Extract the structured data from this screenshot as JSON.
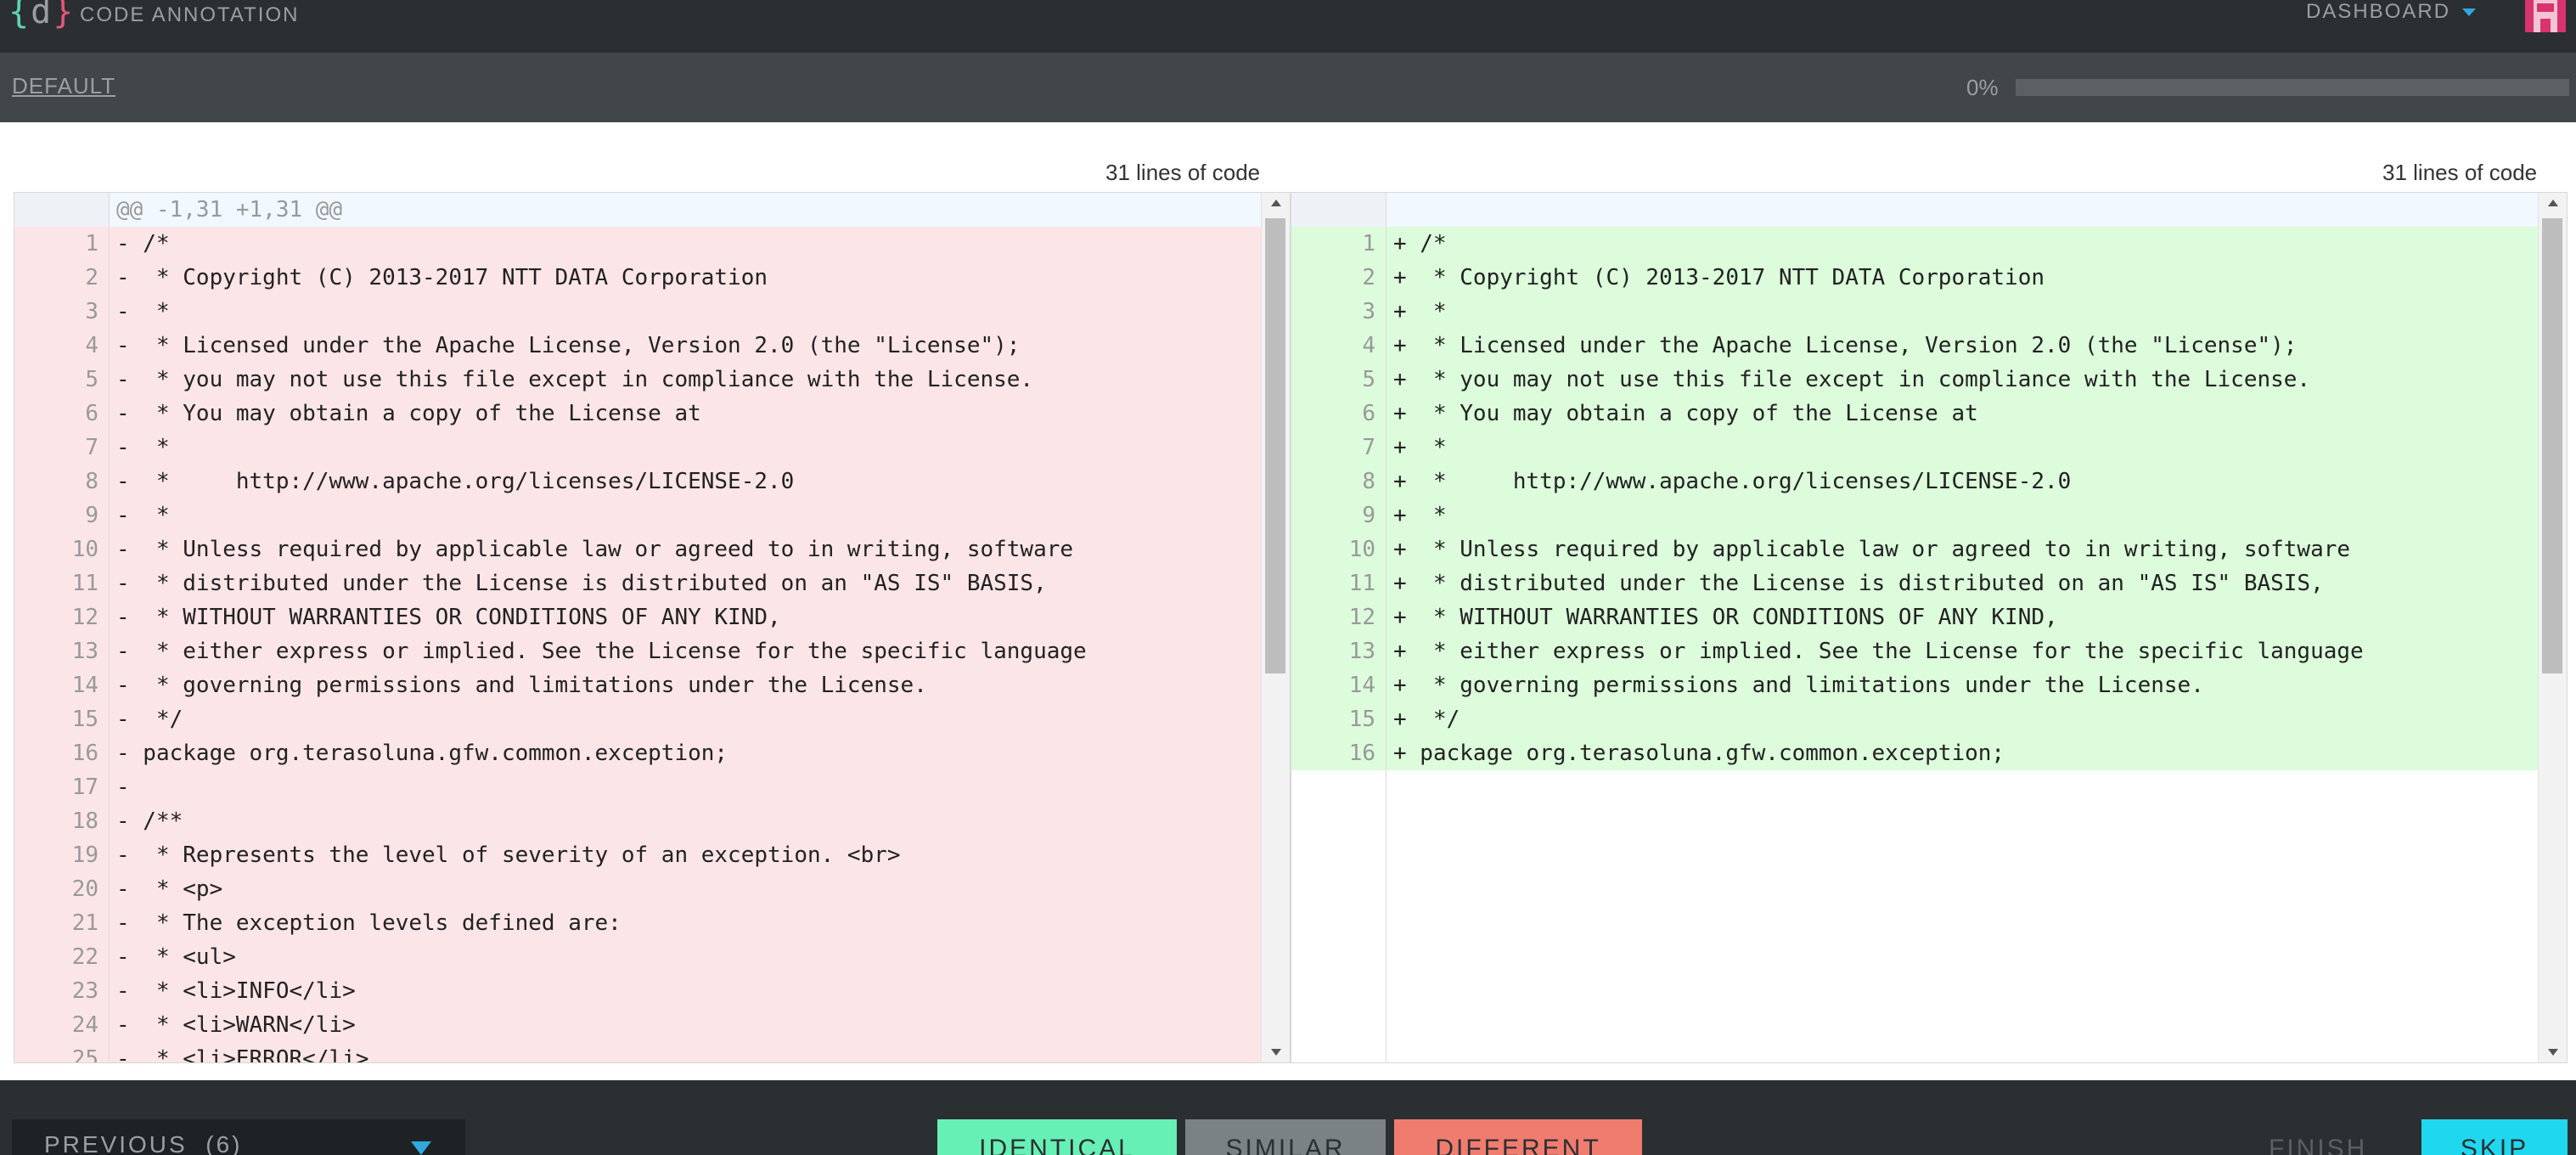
{
  "header": {
    "logo_left": "{",
    "logo_mid": "d",
    "logo_right": "}",
    "app_title": "CODE ANNOTATION",
    "dashboard_label": "DASHBOARD",
    "dropdown_icon": "caret-down-icon",
    "avatar": "identicon-avatar"
  },
  "subbar": {
    "task_label": "DEFAULT",
    "progress_text": "0%",
    "progress_value": 0
  },
  "diff": {
    "hunk_header": "@@ -1,31 +1,31 @@",
    "left": {
      "lines_label": "31 lines of code",
      "lines": [
        {
          "num": "1",
          "text": "- /*"
        },
        {
          "num": "2",
          "text": "-  * Copyright (C) 2013-2017 NTT DATA Corporation"
        },
        {
          "num": "3",
          "text": "-  *"
        },
        {
          "num": "4",
          "text": "-  * Licensed under the Apache License, Version 2.0 (the \"License\");"
        },
        {
          "num": "5",
          "text": "-  * you may not use this file except in compliance with the License."
        },
        {
          "num": "6",
          "text": "-  * You may obtain a copy of the License at"
        },
        {
          "num": "7",
          "text": "-  *"
        },
        {
          "num": "8",
          "text": "-  *     http://www.apache.org/licenses/LICENSE-2.0"
        },
        {
          "num": "9",
          "text": "-  *"
        },
        {
          "num": "10",
          "text": "-  * Unless required by applicable law or agreed to in writing, software"
        },
        {
          "num": "11",
          "text": "-  * distributed under the License is distributed on an \"AS IS\" BASIS,"
        },
        {
          "num": "12",
          "text": "-  * WITHOUT WARRANTIES OR CONDITIONS OF ANY KIND,"
        },
        {
          "num": "13",
          "text": "-  * either express or implied. See the License for the specific language"
        },
        {
          "num": "14",
          "text": "-  * governing permissions and limitations under the License."
        },
        {
          "num": "15",
          "text": "-  */"
        },
        {
          "num": "16",
          "text": "- package org.terasoluna.gfw.common.exception;"
        },
        {
          "num": "17",
          "text": "-"
        },
        {
          "num": "18",
          "text": "- /**"
        },
        {
          "num": "19",
          "text": "-  * Represents the level of severity of an exception. <br>"
        },
        {
          "num": "20",
          "text": "-  * <p>"
        },
        {
          "num": "21",
          "text": "-  * The exception levels defined are:"
        },
        {
          "num": "22",
          "text": "-  * <ul>"
        },
        {
          "num": "23",
          "text": "-  * <li>INFO</li>"
        },
        {
          "num": "24",
          "text": "-  * <li>WARN</li>"
        },
        {
          "num": "25",
          "text": "-  * <li>ERROR</li>"
        }
      ]
    },
    "right": {
      "lines_label": "31 lines of code",
      "lines": [
        {
          "num": "1",
          "text": "+ /*"
        },
        {
          "num": "2",
          "text": "+  * Copyright (C) 2013-2017 NTT DATA Corporation"
        },
        {
          "num": "3",
          "text": "+  *"
        },
        {
          "num": "4",
          "text": "+  * Licensed under the Apache License, Version 2.0 (the \"License\");"
        },
        {
          "num": "5",
          "text": "+  * you may not use this file except in compliance with the License."
        },
        {
          "num": "6",
          "text": "+  * You may obtain a copy of the License at"
        },
        {
          "num": "7",
          "text": "+  *"
        },
        {
          "num": "8",
          "text": "+  *     http://www.apache.org/licenses/LICENSE-2.0"
        },
        {
          "num": "9",
          "text": "+  *"
        },
        {
          "num": "10",
          "text": "+  * Unless required by applicable law or agreed to in writing, software"
        },
        {
          "num": "11",
          "text": "+  * distributed under the License is distributed on an \"AS IS\" BASIS,"
        },
        {
          "num": "12",
          "text": "+  * WITHOUT WARRANTIES OR CONDITIONS OF ANY KIND,"
        },
        {
          "num": "13",
          "text": "+  * either express or implied. See the License for the specific language"
        },
        {
          "num": "14",
          "text": "+  * governing permissions and limitations under the License."
        },
        {
          "num": "15",
          "text": "+  */"
        },
        {
          "num": "16",
          "text": "+ package org.terasoluna.gfw.common.exception;"
        }
      ]
    }
  },
  "footer": {
    "previous_label": "PREVIOUS  (6)",
    "identical_label": "IDENTICAL",
    "similar_label": "SIMILAR",
    "different_label": "DIFFERENT",
    "finish_label": "FINISH",
    "skip_label": "SKIP"
  },
  "colors": {
    "topbar": "#2b2f31",
    "subbar": "#414648",
    "deleted_bg": "#fce5e6",
    "added_bg": "#dcfcdc",
    "identical": "#67f0b6",
    "similar": "#7a8284",
    "different": "#f07c6f",
    "skip": "#1fd8f0",
    "accent": "#2fa8e0"
  }
}
